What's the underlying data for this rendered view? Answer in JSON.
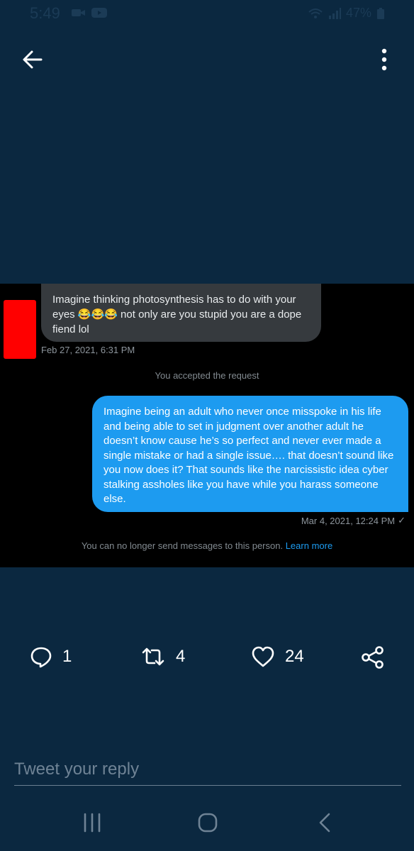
{
  "status_bar": {
    "time": "5:49",
    "battery": "47%"
  },
  "dm": {
    "incoming_text": "Imagine thinking photosynthesis has to do with your eyes 😂😂😂 not only are you stupid you are a dope fiend lol",
    "incoming_time": "Feb 27, 2021, 6:31 PM",
    "accepted_notice": "You accepted the request",
    "outgoing_text": "Imagine being an adult who never once misspoke in his life and being able to set in judgment over another adult he doesn’t know cause he’s so perfect and never ever made a single mistake or had a single issue…. that doesn’t sound like you now does it? That sounds like the narcissistic idea cyber stalking assholes like you have while you harass someone else.",
    "outgoing_time": "Mar 4, 2021, 12:24 PM",
    "read_mark": "✓",
    "no_messages_notice": "You can no longer send messages to this person.",
    "learn_more": "Learn more"
  },
  "actions": {
    "replies": "1",
    "retweets": "4",
    "likes": "24"
  },
  "reply": {
    "placeholder": "Tweet your reply"
  },
  "icons": [
    "back-arrow-icon",
    "more-vertical-icon",
    "reply-icon",
    "retweet-icon",
    "heart-icon",
    "share-icon",
    "recent-apps-icon",
    "home-icon",
    "back-nav-icon"
  ]
}
